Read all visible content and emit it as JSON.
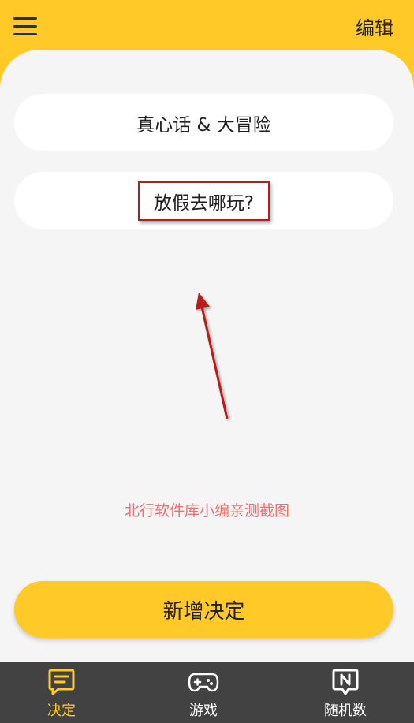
{
  "header": {
    "menu_icon": "hamburger-menu-icon",
    "edit_label": "编辑"
  },
  "decisions": [
    {
      "label": "真心话 & 大冒险"
    },
    {
      "label": "放假去哪玩?"
    }
  ],
  "watermark_text": "北行软件库小编亲测截图",
  "add_button_label": "新增决定",
  "nav": {
    "items": [
      {
        "label": "决定",
        "icon": "decide-card-icon",
        "active": true
      },
      {
        "label": "游戏",
        "icon": "gamepad-icon",
        "active": false
      },
      {
        "label": "随机数",
        "icon": "random-number-icon",
        "active": false
      }
    ]
  },
  "colors": {
    "accent": "#ffca28",
    "background": "#f5f5f5",
    "nav_background": "#424242",
    "annotation_red": "#b71c1c"
  }
}
